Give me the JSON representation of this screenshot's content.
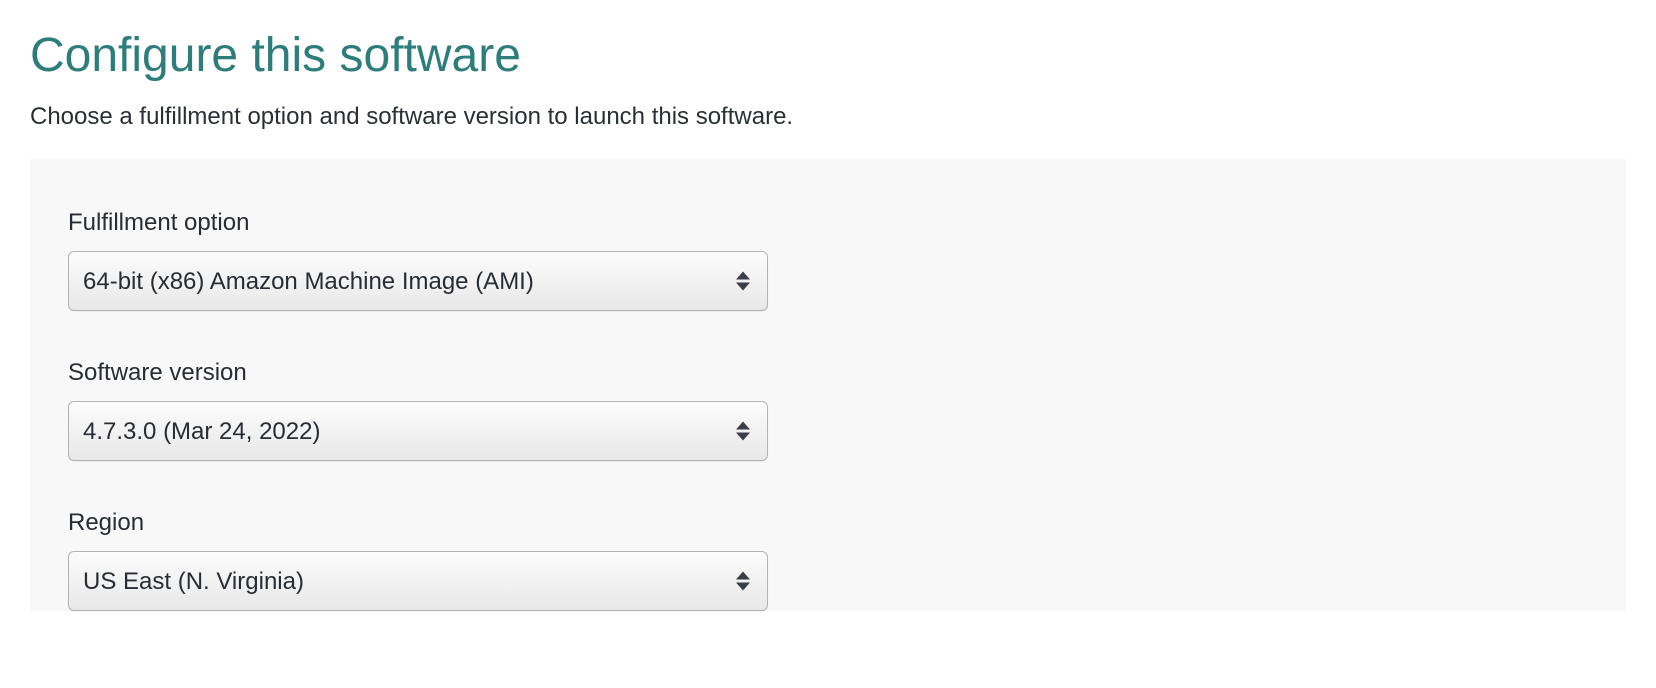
{
  "header": {
    "title": "Configure this software",
    "subtitle": "Choose a fulfillment option and software version to launch this software."
  },
  "form": {
    "fulfillment": {
      "label": "Fulfillment option",
      "value": "64-bit (x86) Amazon Machine Image (AMI)"
    },
    "version": {
      "label": "Software version",
      "value": "4.7.3.0 (Mar 24, 2022)"
    },
    "region": {
      "label": "Region",
      "value": "US East (N. Virginia)"
    }
  }
}
